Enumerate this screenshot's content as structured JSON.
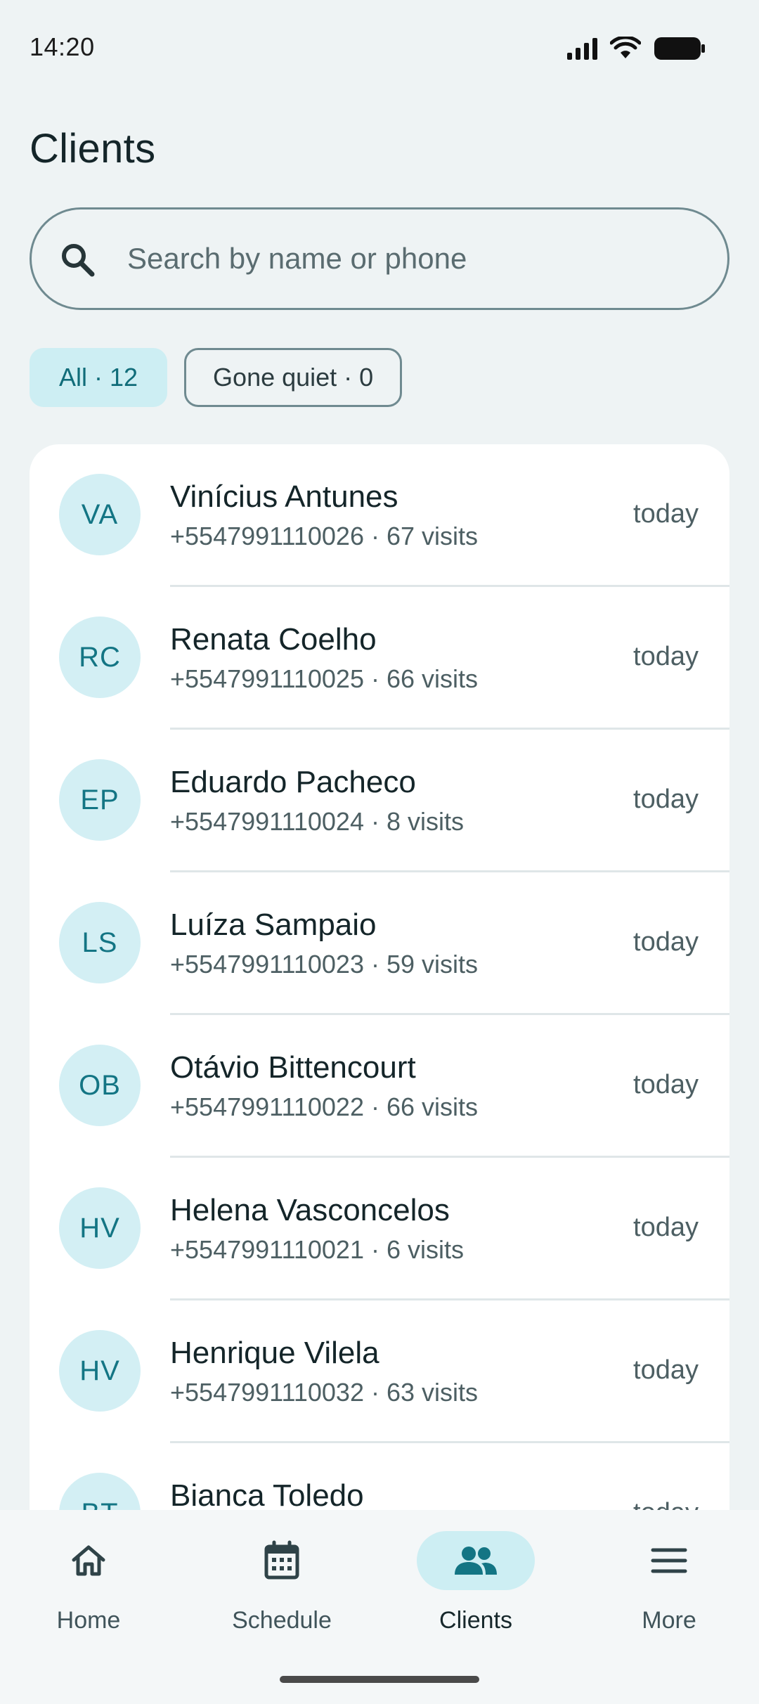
{
  "status_bar": {
    "time": "14:20",
    "icons": [
      "signal-icon",
      "wifi-icon",
      "battery-icon"
    ]
  },
  "page": {
    "title": "Clients"
  },
  "search": {
    "placeholder": "Search by name or phone",
    "value": "",
    "icon": "search-icon"
  },
  "filters": [
    {
      "label": "All · 12",
      "active": true
    },
    {
      "label": "Gone quiet · 0",
      "active": false
    }
  ],
  "clients": [
    {
      "initials": "VA",
      "name": "Vinícius Antunes",
      "detail": "+5547991110026 · 67 visits",
      "last_seen": "today"
    },
    {
      "initials": "RC",
      "name": "Renata Coelho",
      "detail": "+5547991110025 · 66 visits",
      "last_seen": "today"
    },
    {
      "initials": "EP",
      "name": "Eduardo Pacheco",
      "detail": "+5547991110024 · 8 visits",
      "last_seen": "today"
    },
    {
      "initials": "LS",
      "name": "Luíza Sampaio",
      "detail": "+5547991110023 · 59 visits",
      "last_seen": "today"
    },
    {
      "initials": "OB",
      "name": "Otávio Bittencourt",
      "detail": "+5547991110022 · 66 visits",
      "last_seen": "today"
    },
    {
      "initials": "HV",
      "name": "Helena Vasconcelos",
      "detail": "+5547991110021 · 6 visits",
      "last_seen": "today"
    },
    {
      "initials": "HV",
      "name": "Henrique Vilela",
      "detail": "+5547991110032 · 63 visits",
      "last_seen": "today"
    },
    {
      "initials": "BT",
      "name": "Bianca Toledo",
      "detail": "",
      "last_seen": "today"
    }
  ],
  "bottom_nav": [
    {
      "label": "Home",
      "icon": "home-icon",
      "active": false
    },
    {
      "label": "Schedule",
      "icon": "calendar-icon",
      "active": false
    },
    {
      "label": "Clients",
      "icon": "people-icon",
      "active": true
    },
    {
      "label": "More",
      "icon": "menu-icon",
      "active": false
    }
  ],
  "colors": {
    "accent": "#137584",
    "accent_bg": "#cdeef3",
    "background": "#eef3f4",
    "surface": "#ffffff"
  }
}
